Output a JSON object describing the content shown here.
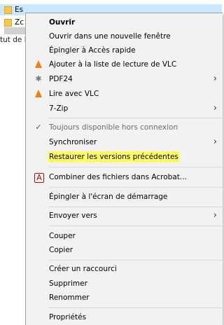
{
  "background": {
    "row1_text": "Es",
    "row2_text": "Zc",
    "status_text": "tut de l"
  },
  "menu": {
    "items": [
      {
        "label": "Ouvrir"
      },
      {
        "label": "Ouvrir dans une nouvelle fenêtre"
      },
      {
        "label": "Épingler à Accès rapide"
      },
      {
        "label": "Ajouter à la liste de lecture de VLC"
      },
      {
        "label": "PDF24"
      },
      {
        "label": "Lire avec VLC"
      },
      {
        "label": "7-Zip"
      },
      {
        "label": "Toujours disponible hors connexion"
      },
      {
        "label": "Synchroniser"
      },
      {
        "label": "Restaurer les versions précédentes"
      },
      {
        "label": "Combiner des fichiers dans Acrobat..."
      },
      {
        "label": "Épingler à l'écran de démarrage"
      },
      {
        "label": "Envoyer vers"
      },
      {
        "label": "Couper"
      },
      {
        "label": "Copier"
      },
      {
        "label": "Créer un raccourci"
      },
      {
        "label": "Supprimer"
      },
      {
        "label": "Renommer"
      },
      {
        "label": "Propriétés"
      }
    ],
    "arrow_glyph": "›"
  },
  "colors": {
    "highlight": "#ffff66",
    "menu_bg": "#f2f2f2",
    "selection_bg": "#cce8ff",
    "vlc_orange": "#ef7d0f"
  }
}
